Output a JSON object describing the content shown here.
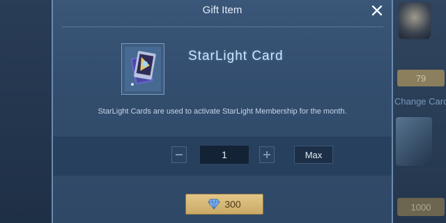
{
  "dialog": {
    "title": "Gift Item",
    "item_name": "StarLight Card",
    "description": "StarLight Cards are used to activate StarLight Membership for the month."
  },
  "quantity": {
    "value": "1",
    "max_label": "Max"
  },
  "purchase": {
    "price": "300",
    "currency_icon": "diamond-icon"
  },
  "background": {
    "price_top": "79",
    "change_label": "Change Card",
    "price_bottom": "1000"
  },
  "colors": {
    "dialog_bg": "#355173",
    "accent_gold": "#d8bb7a",
    "item_name_color": "#cfe6ff"
  }
}
